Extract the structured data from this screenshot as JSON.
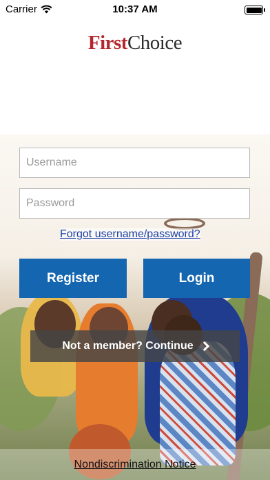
{
  "status_bar": {
    "carrier": "Carrier",
    "time": "10:37 AM",
    "icons": [
      "wifi-icon",
      "battery-icon"
    ]
  },
  "logo": {
    "first": "First",
    "choice": "Choice",
    "colors": {
      "first": "#b3282e",
      "choice": "#2b2b2b"
    }
  },
  "form": {
    "username_placeholder": "Username",
    "password_placeholder": "Password",
    "forgot_label": "Forgot username/password?"
  },
  "actions": {
    "register_label": "Register",
    "login_label": "Login",
    "not_member_label": "Not a member? Continue",
    "accent_color": "#1466b0"
  },
  "footer": {
    "nondiscrimination_label": "Nondiscrimination Notice"
  }
}
